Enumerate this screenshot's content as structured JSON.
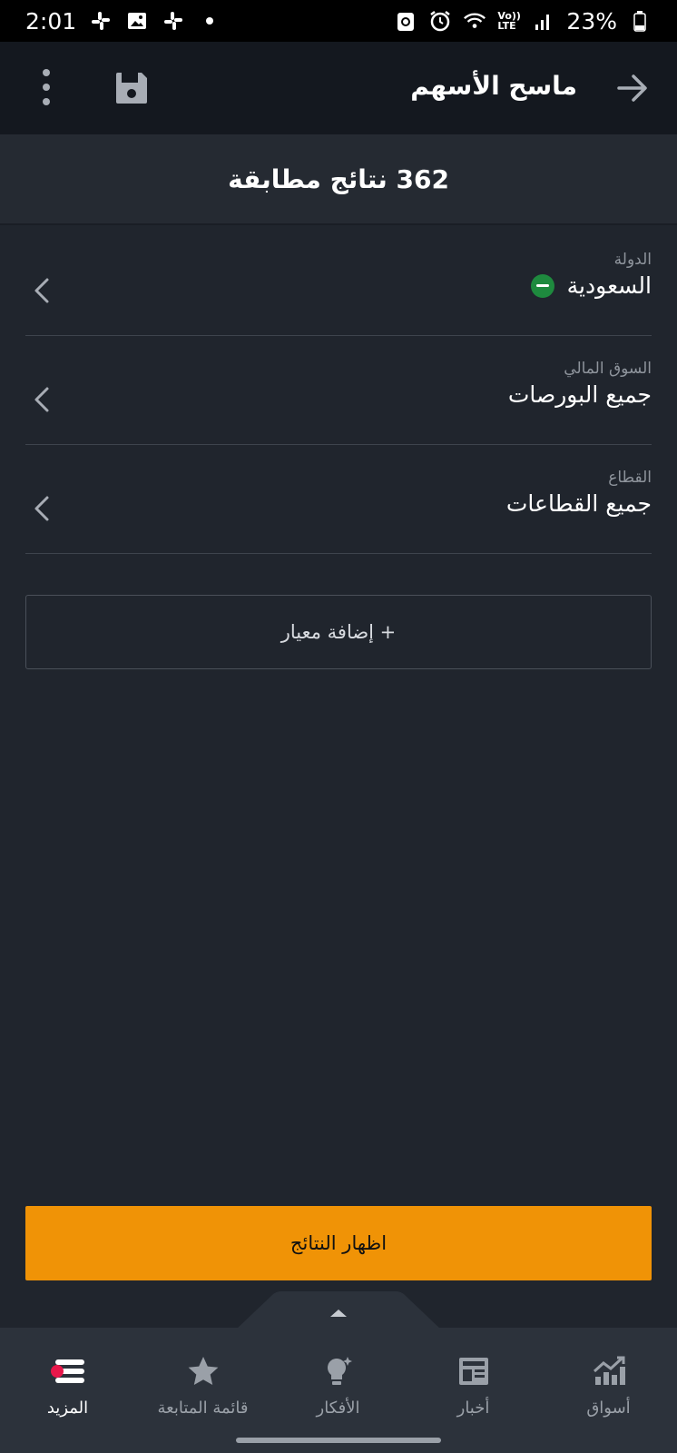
{
  "status_bar": {
    "time": "2:01",
    "battery": "23%",
    "network": "Vo)) LTE"
  },
  "app_bar": {
    "title": "ماسح الأسهم"
  },
  "results": {
    "count_text": "362 نتائج مطابقة"
  },
  "filters": [
    {
      "label": "الدولة",
      "value": "السعودية",
      "icon": "saudi-flag-icon"
    },
    {
      "label": "السوق المالي",
      "value": "جميع البورصات"
    },
    {
      "label": "القطاع",
      "value": "جميع القطاعات"
    }
  ],
  "add_criteria": {
    "label": "+ إضافة معيار"
  },
  "show_results": {
    "label": "اظهار النتائج"
  },
  "bottom_nav": {
    "items": [
      {
        "label": "المزيد",
        "icon": "menu-icon",
        "active": true
      },
      {
        "label": "قائمة المتابعة",
        "icon": "star-icon",
        "active": false
      },
      {
        "label": "الأفكار",
        "icon": "lightbulb-icon",
        "active": false
      },
      {
        "label": "أخبار",
        "icon": "newspaper-icon",
        "active": false
      },
      {
        "label": "أسواق",
        "icon": "chart-icon",
        "active": false
      }
    ]
  },
  "colors": {
    "background": "#20252d",
    "app_bar": "#14181f",
    "accent": "#f09306",
    "notification_dot": "#e8174a"
  }
}
